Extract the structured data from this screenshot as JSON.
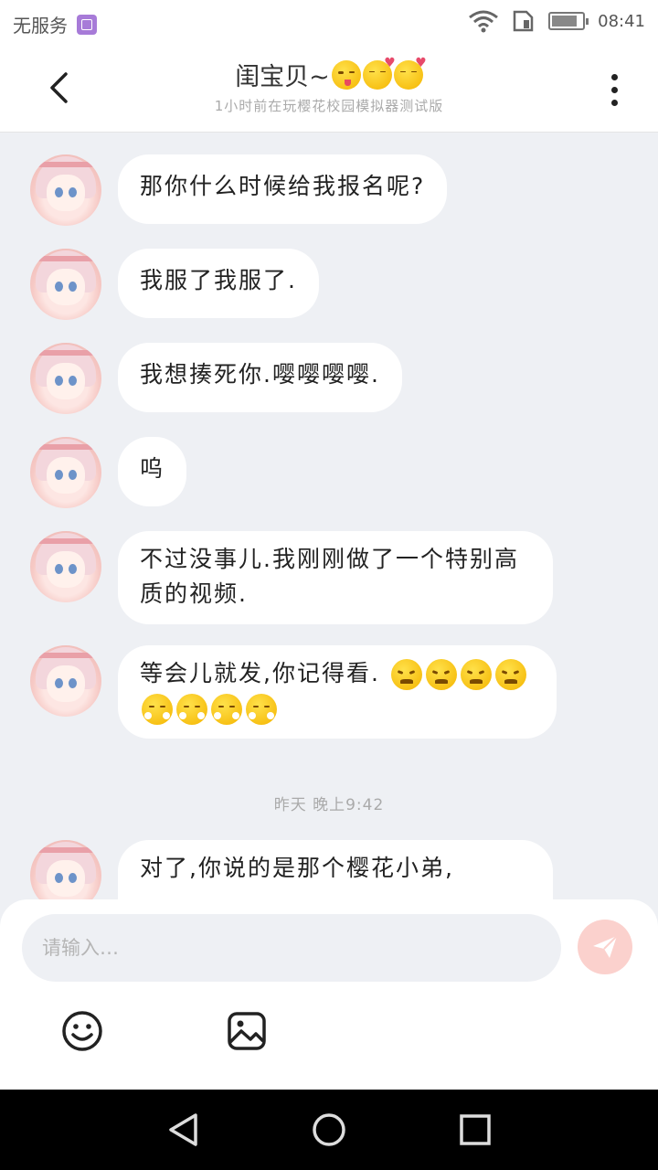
{
  "status_bar": {
    "carrier": "无服务",
    "time": "08:41",
    "icons": [
      "gallery-icon",
      "wifi-icon",
      "sim-icon",
      "battery-icon"
    ],
    "battery_level": 0.85
  },
  "header": {
    "title": "闺宝贝~",
    "title_emojis": [
      "tongue-out-emoji",
      "kiss-heart-emoji",
      "kiss-heart-emoji"
    ],
    "subtitle": "1小时前在玩樱花校园模拟器测试版"
  },
  "messages": [
    {
      "text": "那你什么时候给我报名呢?"
    },
    {
      "text": "我服了我服了."
    },
    {
      "text": "我想揍死你.嘤嘤嘤嘤."
    },
    {
      "text": "呜"
    },
    {
      "text": "不过没事儿.我刚刚做了一个特别高质的视频."
    },
    {
      "text": "等会儿就发,你记得看.",
      "emojis": [
        "angry",
        "angry",
        "angry",
        "angry",
        "pout",
        "pout",
        "pout",
        "pout"
      ]
    },
    {
      "text": "对了,你说的是那个樱花小弟,"
    }
  ],
  "time_divider": "昨天 晚上9:42",
  "composer": {
    "placeholder": "请输入…",
    "value": ""
  },
  "colors": {
    "background": "#eef0f4",
    "bubble": "#ffffff",
    "send_button": "#fbd1cd",
    "emoji_yellow": "#f4b400"
  }
}
